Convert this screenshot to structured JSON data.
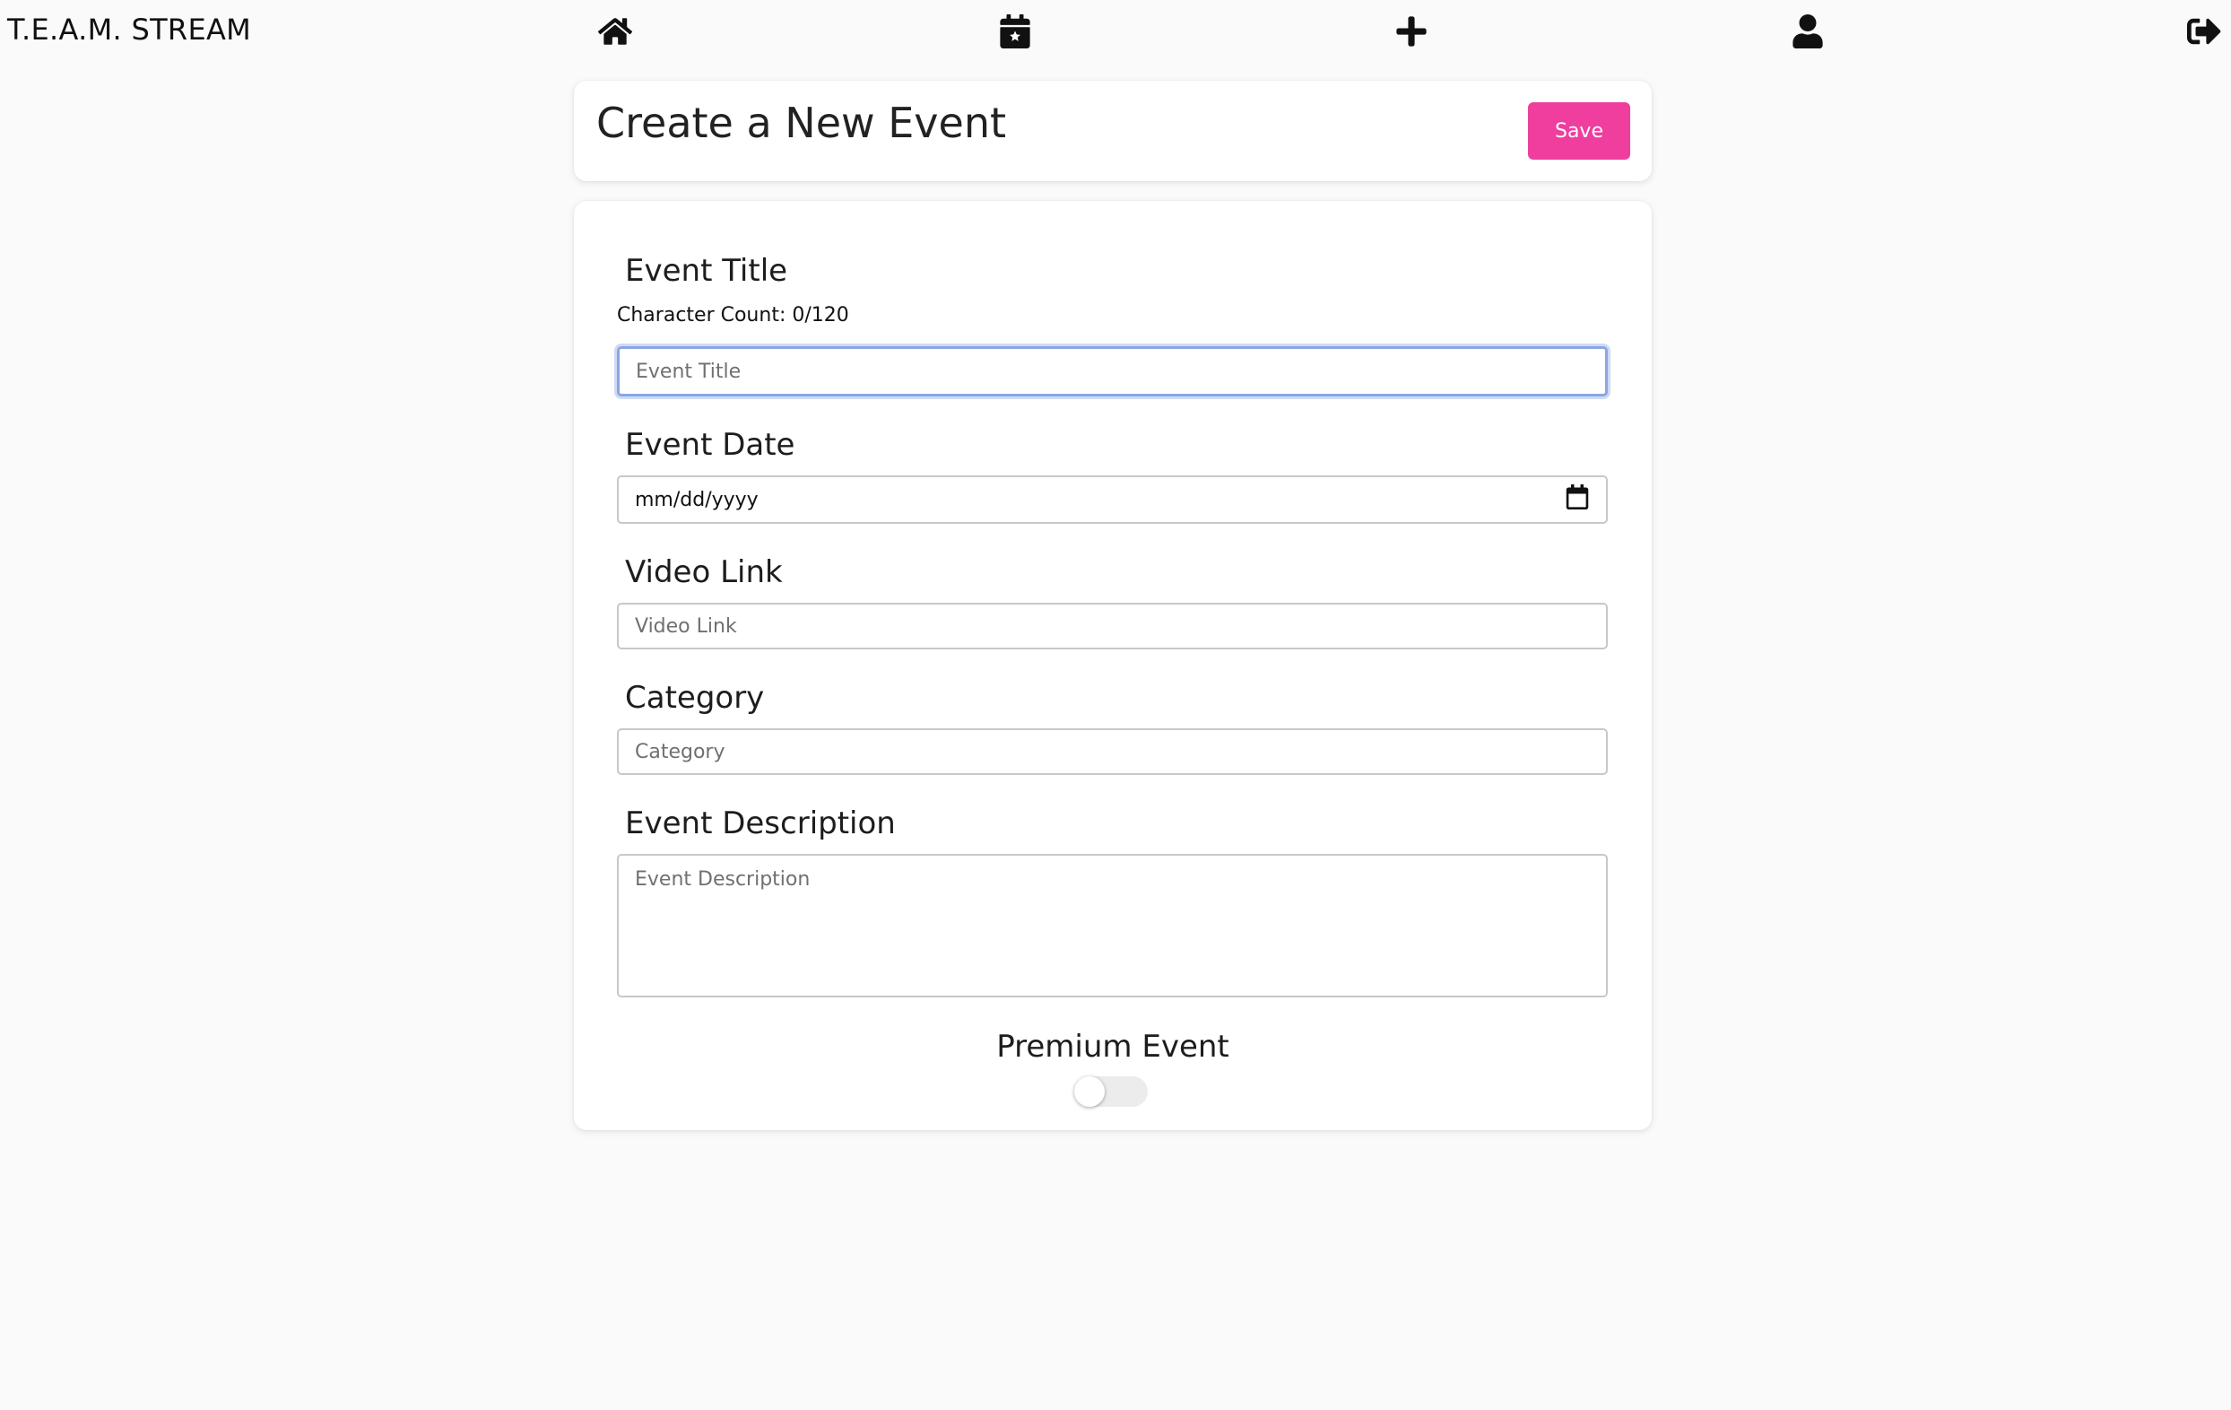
{
  "navbar": {
    "brand": "T.E.A.M. STREAM",
    "icons": [
      "home-icon",
      "calendar-star-icon",
      "plus-icon",
      "user-icon",
      "logout-icon"
    ]
  },
  "header": {
    "title": "Create a New Event",
    "save_label": "Save"
  },
  "form": {
    "title": {
      "label": "Event Title",
      "char_count": "Character Count: 0/120",
      "placeholder": "Event Title",
      "value": ""
    },
    "date": {
      "label": "Event Date",
      "placeholder": "mm/dd/yyyy"
    },
    "video": {
      "label": "Video Link",
      "placeholder": "Video Link"
    },
    "category": {
      "label": "Category",
      "placeholder": "Category"
    },
    "description": {
      "label": "Event Description",
      "placeholder": "Event Description"
    },
    "premium": {
      "label": "Premium Event",
      "enabled": false
    }
  },
  "colors": {
    "accent": "#ef3e9e",
    "background": "#fafafa",
    "focus_ring": "#89a7e0"
  }
}
